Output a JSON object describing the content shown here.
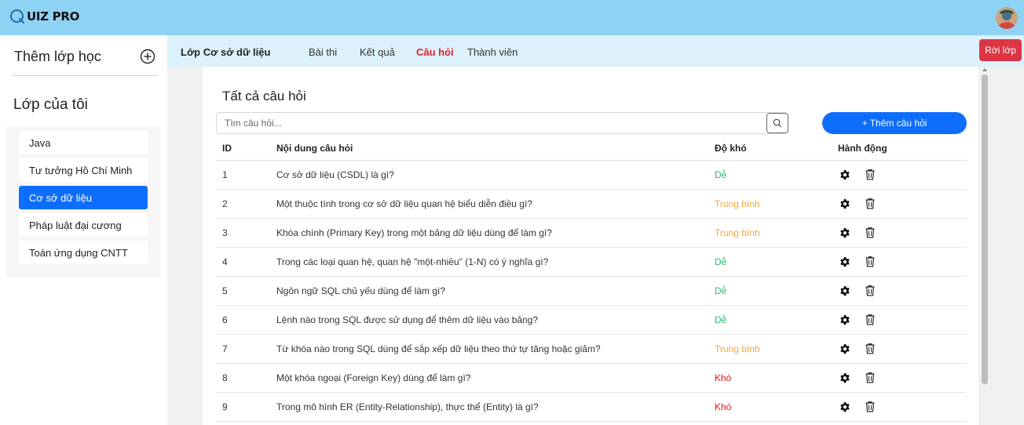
{
  "header": {
    "logo_text": "UIZ PRO",
    "logo_icon": "q-logo-icon",
    "avatar_icon": "user-avatar"
  },
  "sidebar": {
    "add_class_label": "Thêm lớp học",
    "my_classes_title": "Lớp của tôi",
    "items": [
      {
        "label": "Java",
        "active": false
      },
      {
        "label": "Tư tưởng Hồ Chí Minh",
        "active": false
      },
      {
        "label": "Cơ sở dữ liệu",
        "active": true
      },
      {
        "label": "Pháp luật đại cương",
        "active": false
      },
      {
        "label": "Toán ứng dụng CNTT",
        "active": false
      }
    ]
  },
  "subnav": {
    "class_name": "Lớp Cơ sở dữ liệu",
    "tabs": [
      {
        "label": "Bài thi",
        "active": false
      },
      {
        "label": "Kết quả",
        "active": false
      },
      {
        "label": "Câu hỏi",
        "active": true
      },
      {
        "label": "Thành viên",
        "active": false
      }
    ],
    "leave_label": "Rời lớp"
  },
  "main": {
    "title": "Tất cả câu hỏi",
    "search_placeholder": "Tìm câu hỏi...",
    "add_question_label": "+ Thêm câu hỏi",
    "columns": [
      "ID",
      "Nội dung câu hỏi",
      "Độ khó",
      "Hành động"
    ],
    "rows": [
      {
        "id": "1",
        "content": "Cơ sở dữ liệu (CSDL) là gì?",
        "difficulty": "Dễ",
        "level": "easy"
      },
      {
        "id": "2",
        "content": "Một thuộc tính trong cơ sở dữ liệu quan hệ biểu diễn điều gì?",
        "difficulty": "Trung bình",
        "level": "med"
      },
      {
        "id": "3",
        "content": "Khóa chính (Primary Key) trong một bảng dữ liệu dùng để làm gì?",
        "difficulty": "Trung bình",
        "level": "med"
      },
      {
        "id": "4",
        "content": "Trong các loại quan hệ, quan hệ \"một-nhiều\" (1-N) có ý nghĩa gì?",
        "difficulty": "Dễ",
        "level": "easy"
      },
      {
        "id": "5",
        "content": "Ngôn ngữ SQL chủ yếu dùng để làm gì?",
        "difficulty": "Dễ",
        "level": "easy"
      },
      {
        "id": "6",
        "content": "Lệnh nào trong SQL được sử dụng để thêm dữ liệu vào bảng?",
        "difficulty": "Dễ",
        "level": "easy"
      },
      {
        "id": "7",
        "content": "Từ khóa nào trong SQL dùng để sắp xếp dữ liệu theo thứ tự tăng hoặc giảm?",
        "difficulty": "Trung bình",
        "level": "med"
      },
      {
        "id": "8",
        "content": "Một khóa ngoại (Foreign Key) dùng để làm gì?",
        "difficulty": "Khó",
        "level": "hard"
      },
      {
        "id": "9",
        "content": "Trong mô hình ER (Entity-Relationship), thực thể (Entity) là gì?",
        "difficulty": "Khó",
        "level": "hard"
      }
    ]
  },
  "colors": {
    "topbar": "#8fd3f4",
    "subnav": "#dcf1fb",
    "primary": "#0d6efd",
    "danger": "#dc3545",
    "easy": "#2eb872",
    "medium": "#f0a742",
    "hard": "#e4161b"
  }
}
